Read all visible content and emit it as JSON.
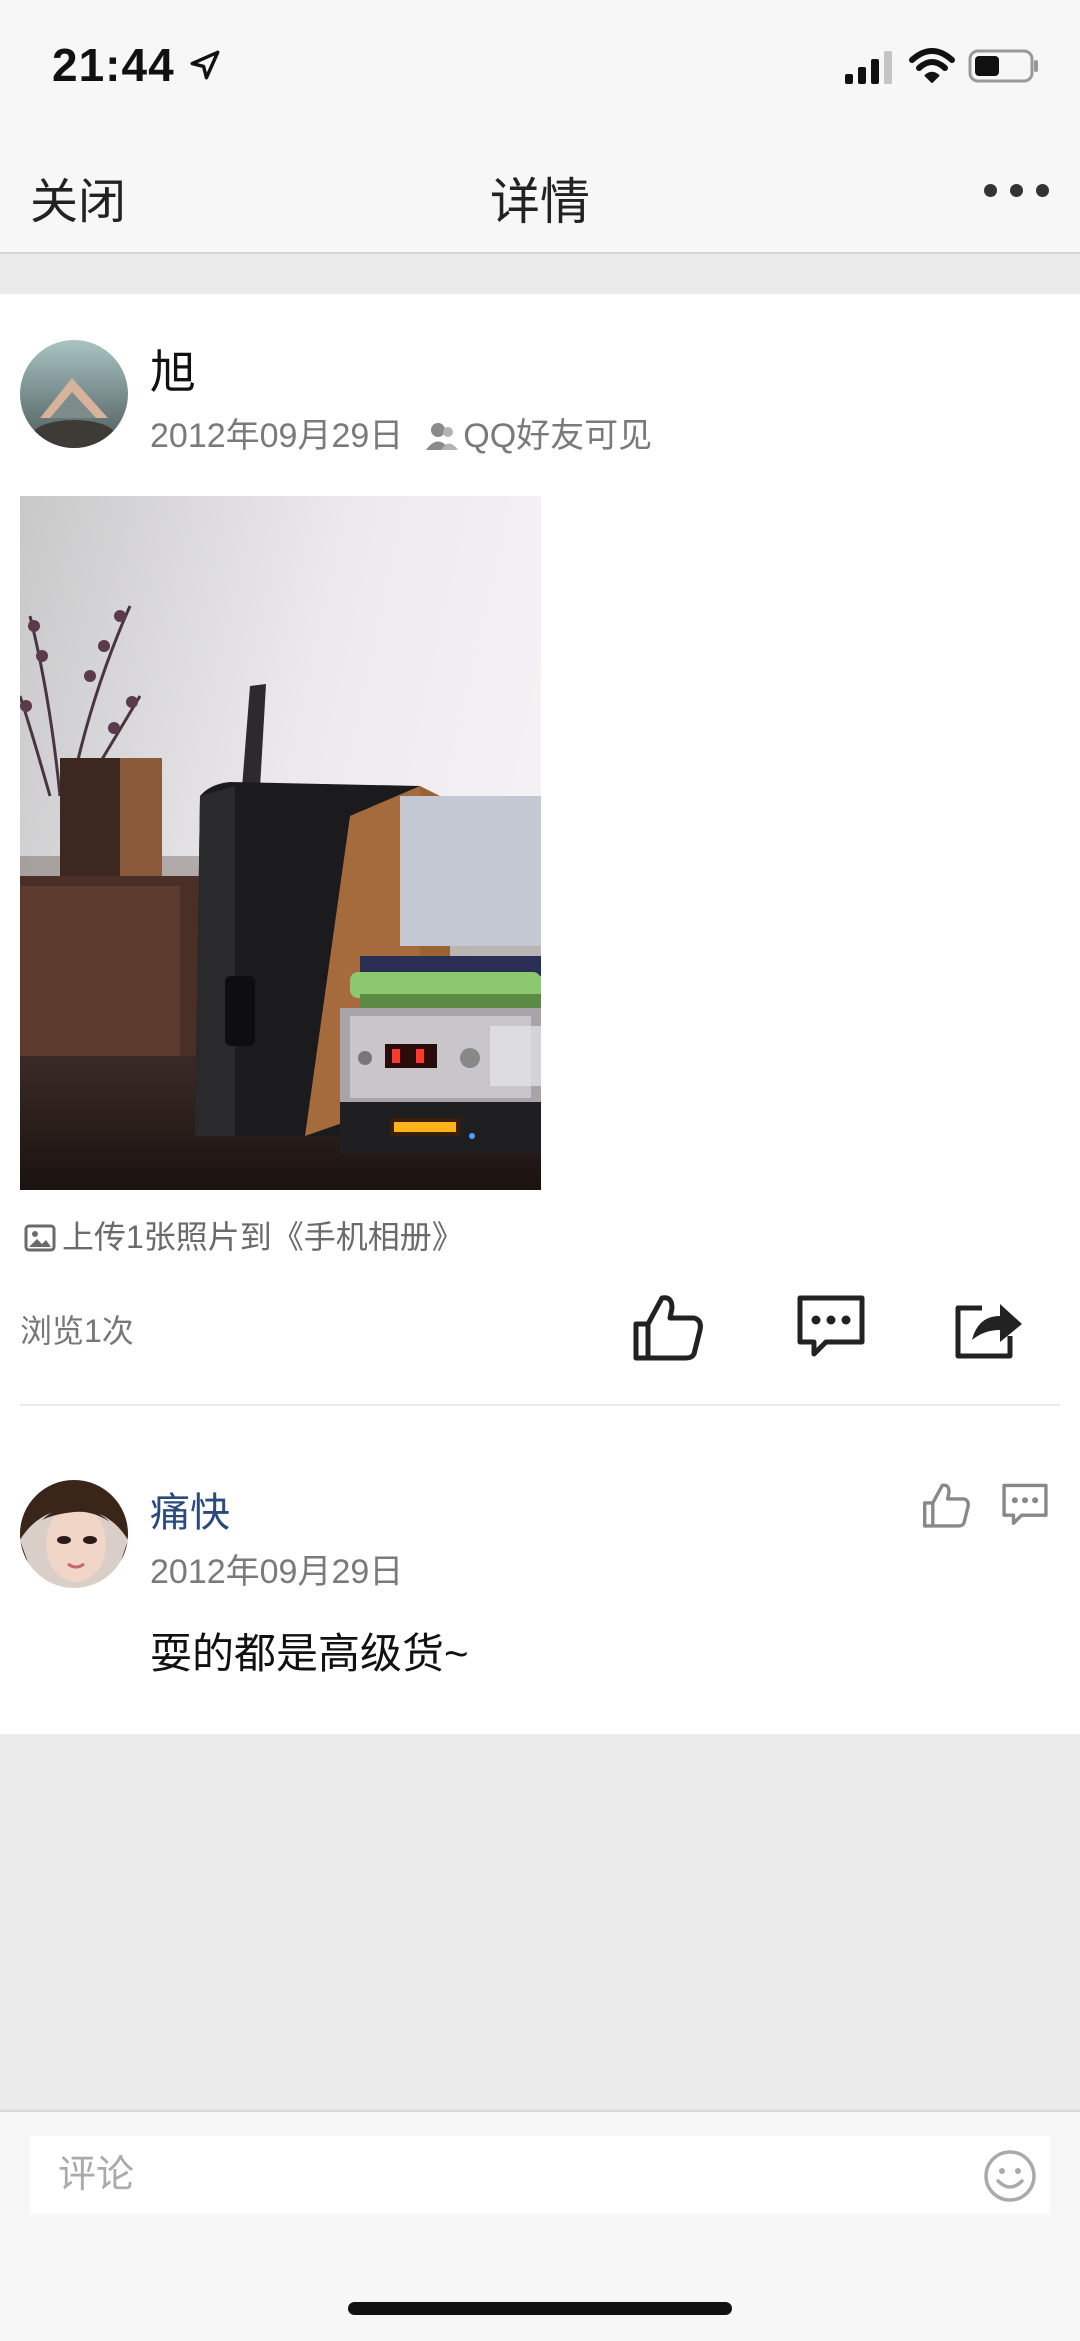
{
  "status_bar": {
    "time": "21:44"
  },
  "nav": {
    "close_label": "关闭",
    "title": "详情"
  },
  "post": {
    "author": "旭",
    "date": "2012年09月29日",
    "visibility": "QQ好友可见",
    "upload_text": "上传1张照片到《手机相册》",
    "views": "浏览1次"
  },
  "comment": {
    "author": "痛快",
    "date": "2012年09月29日",
    "text": "耍的都是高级货~"
  },
  "bottom": {
    "placeholder": "评论"
  },
  "colors": {
    "commenter_name": "#2b4a7c",
    "meta_text": "#7a7a7a",
    "page_bg": "#ebebeb"
  },
  "icons": [
    "location-arrow-icon",
    "signal-icon",
    "wifi-icon",
    "battery-icon",
    "more-icon",
    "friends-icon",
    "image-icon",
    "like-icon",
    "comment-icon",
    "share-icon",
    "emoji-icon"
  ]
}
